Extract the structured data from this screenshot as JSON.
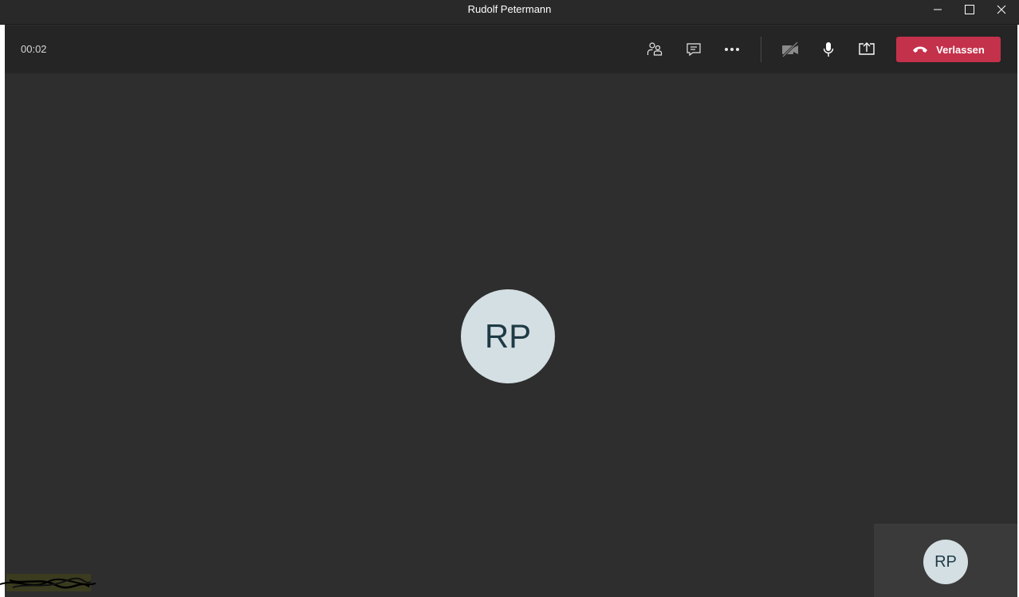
{
  "window": {
    "title": "Rudolf Petermann",
    "controls": [
      "minimize-icon",
      "maximize-icon",
      "close-icon"
    ]
  },
  "call": {
    "timer": "00:02",
    "controls": [
      {
        "name": "participants-button",
        "icon": "people-icon"
      },
      {
        "name": "chat-button",
        "icon": "chat-icon"
      },
      {
        "name": "more-actions-button",
        "icon": "more-icon"
      },
      {
        "name": "camera-toggle-button",
        "icon": "camera-off-icon"
      },
      {
        "name": "microphone-toggle-button",
        "icon": "microphone-icon"
      },
      {
        "name": "share-screen-button",
        "icon": "share-screen-icon"
      }
    ],
    "leave_label": "Verlassen",
    "leave_color": "#c4314b"
  },
  "participant": {
    "initials": "RP"
  },
  "self_view": {
    "initials": "RP"
  },
  "colors": {
    "background": "#2e2e2e",
    "callbar": "#252525",
    "avatar": "#d4dfe3",
    "avatar_text": "#1e3b45"
  }
}
